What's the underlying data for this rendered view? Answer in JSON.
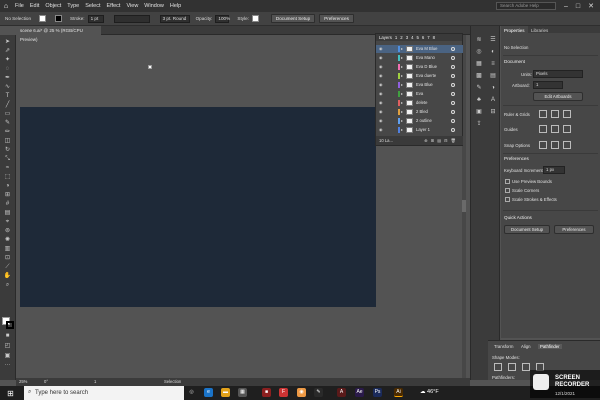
{
  "menu": {
    "app_logo": "Ai",
    "items": [
      "File",
      "Edit",
      "Object",
      "Type",
      "Select",
      "Effect",
      "View",
      "Window",
      "Help"
    ],
    "search_placeholder": "Search Adobe Help"
  },
  "control_bar": {
    "selection": "No Selection",
    "stroke_label": "Stroke:",
    "stroke_value": "1 pt",
    "brush": "3 pt. Round",
    "opacity_label": "Opacity:",
    "opacity_value": "100%",
    "style_label": "Style:",
    "doc_setup": "Document Setup",
    "preferences": "Preferences"
  },
  "document_tab": "scene 6.ai* @ 25 % (RGB/CPU Preview)",
  "layers_panel": {
    "title": "Layers",
    "header_tabs": [
      "Layers",
      "1",
      "2",
      "3",
      "4",
      "5",
      "6",
      "7",
      "8"
    ],
    "rows": [
      {
        "name": "Eva M Blue",
        "color": "#4f8fe0",
        "selected": true
      },
      {
        "name": "Eva Mano",
        "color": "#44c0c0",
        "selected": false
      },
      {
        "name": "Eva D Blue",
        "color": "#f070b0",
        "selected": false
      },
      {
        "name": "Eva duerte",
        "color": "#a0d040",
        "selected": false
      },
      {
        "name": "Eva Blue",
        "color": "#9060e0",
        "selected": false
      },
      {
        "name": "Eva",
        "color": "#40a040",
        "selected": false
      },
      {
        "name": "delete",
        "color": "#e06060",
        "selected": false
      },
      {
        "name": "2 Bled",
        "color": "#e0a040",
        "selected": false
      },
      {
        "name": "2 outline",
        "color": "#60a0f0",
        "selected": false
      },
      {
        "name": "Layer 1",
        "color": "#5080e0",
        "selected": false
      }
    ],
    "footer": "10 La..."
  },
  "properties_panel": {
    "tabs": [
      "Properties",
      "Libraries"
    ],
    "no_selection": "No Selection",
    "document": "Document",
    "units_label": "Units:",
    "units_value": "Pixels",
    "artboard_label": "Artboard:",
    "artboard_value": "1",
    "edit_artboards": "Edit Artboards",
    "ruler_grids": "Ruler & Grids",
    "guides": "Guides",
    "snap_options": "Snap Options",
    "preferences": "Preferences",
    "keyboard_increment_label": "Keyboard Increment:",
    "keyboard_increment_value": "1 px",
    "use_preview_bounds": "Use Preview Bounds",
    "scale_corners": "Scale Corners",
    "scale_strokes": "Scale Strokes & Effects",
    "quick_actions": "Quick Actions",
    "document_setup": "Document Setup",
    "preferences_btn": "Preferences"
  },
  "bottom_panel": {
    "tabs": [
      "Transform",
      "Align",
      "Pathfinder"
    ],
    "shape_modes": "Shape Modes:",
    "pathfinders": "Pathfinders:"
  },
  "status_bar": {
    "zoom": "25%",
    "angle": "0°",
    "page": "1",
    "tool": "Selection"
  },
  "taskbar": {
    "search_placeholder": "Type here to search",
    "temperature": "46°F",
    "date": "12/1/2021"
  },
  "recorder": {
    "line1": "SCREEN",
    "line2": "RECORDER"
  },
  "colors": {
    "artboard": "#1e2938",
    "selected_row": "#4a6382",
    "ui_dark": "#323232"
  }
}
